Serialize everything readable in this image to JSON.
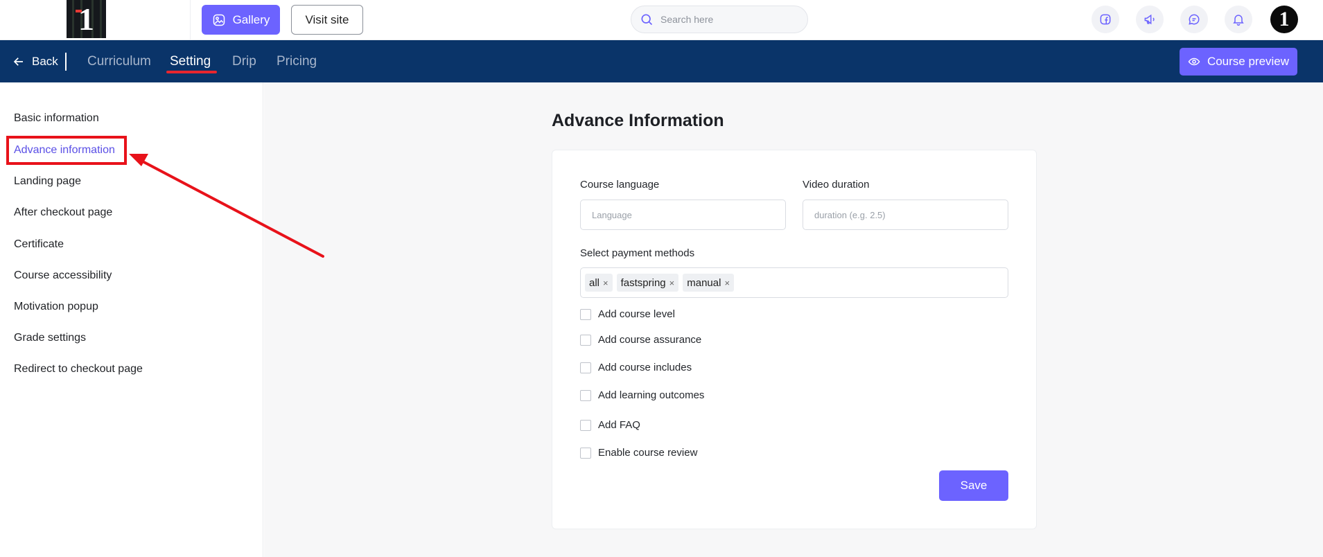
{
  "header": {
    "logo_text": "1",
    "gallery_label": "Gallery",
    "visit_site_label": "Visit site",
    "search": {
      "placeholder": "Search here"
    },
    "icons": [
      "facebook-icon",
      "megaphone-icon",
      "chat-icon",
      "bell-icon"
    ],
    "avatar_text": "1"
  },
  "nav": {
    "back_label": "Back",
    "tabs": [
      {
        "label": "Curriculum",
        "active": false
      },
      {
        "label": "Setting",
        "active": true
      },
      {
        "label": "Drip",
        "active": false
      },
      {
        "label": "Pricing",
        "active": false
      }
    ],
    "preview_label": "Course preview"
  },
  "sidebar": {
    "items": [
      {
        "label": "Basic information"
      },
      {
        "label": "Advance information",
        "active": true
      },
      {
        "label": "Landing page"
      },
      {
        "label": "After checkout page"
      },
      {
        "label": "Certificate"
      },
      {
        "label": "Course accessibility"
      },
      {
        "label": "Motivation popup"
      },
      {
        "label": "Grade settings"
      },
      {
        "label": "Redirect to checkout page"
      }
    ]
  },
  "main": {
    "title": "Advance Information",
    "language": {
      "label": "Course language",
      "placeholder": "Language",
      "value": ""
    },
    "duration": {
      "label": "Video duration",
      "placeholder": "duration (e.g. 2.5)",
      "value": ""
    },
    "payment": {
      "label": "Select payment methods",
      "tags": [
        "all",
        "fastspring",
        "manual"
      ]
    },
    "checkboxes": [
      {
        "label": "Add course level",
        "checked": false
      },
      {
        "label": "Add course assurance",
        "checked": false
      },
      {
        "label": "Add course includes",
        "checked": false
      },
      {
        "label": "Add learning outcomes",
        "checked": false
      },
      {
        "label": "Add FAQ",
        "checked": false
      },
      {
        "label": "Enable course review",
        "checked": false
      }
    ],
    "save_label": "Save"
  },
  "colors": {
    "accent": "#6c63ff",
    "navbar": "#0a3469",
    "highlight": "#e8121a",
    "active_side": "#5a4fe6"
  }
}
